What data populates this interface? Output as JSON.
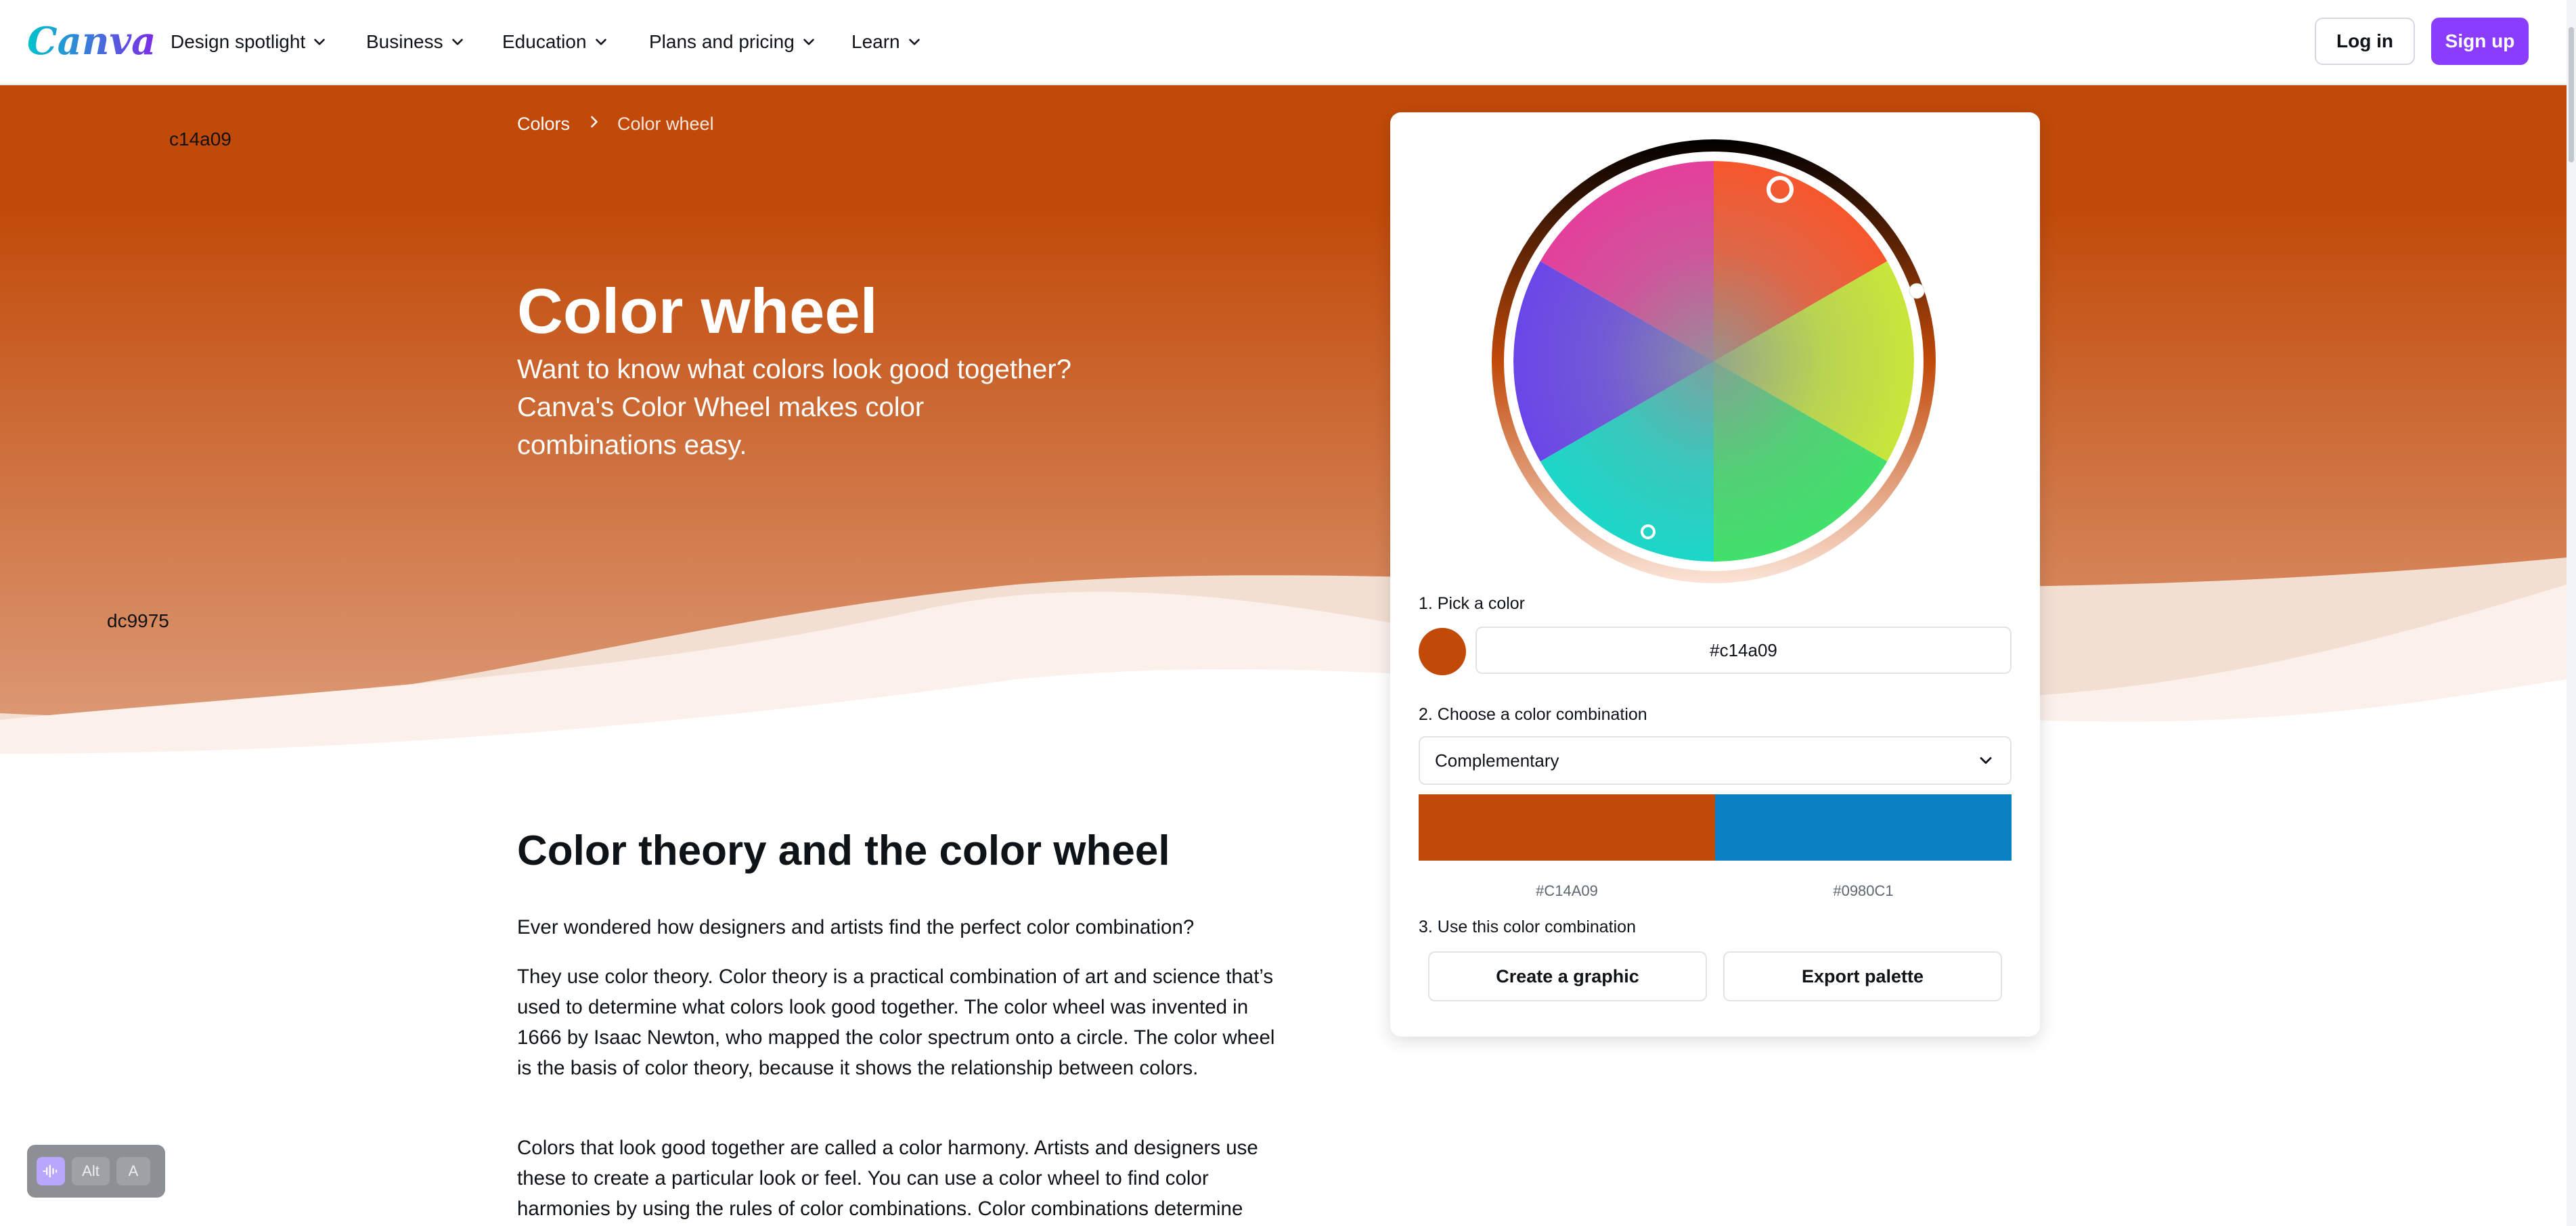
{
  "nav": {
    "logo": "Canva",
    "items": [
      "Design spotlight",
      "Business",
      "Education",
      "Plans and pricing",
      "Learn"
    ],
    "login": "Log in",
    "signup": "Sign up"
  },
  "breadcrumb": {
    "items": [
      "Colors",
      "Color wheel"
    ]
  },
  "hero": {
    "title": "Color wheel",
    "subtitle": "Want to know what colors look good together? Canva's Color Wheel makes color combinations easy.",
    "debug_top": "c14a09",
    "debug_bottom": "dc9975"
  },
  "tool": {
    "step1": "1. Pick a color",
    "hex_value": "#c14a09",
    "step2": "2. Choose a color combination",
    "combination": "Complementary",
    "swatches": [
      {
        "color": "#c14a09",
        "label": "#C14A09"
      },
      {
        "color": "#0980c1",
        "label": "#0980C1"
      }
    ],
    "step3": "3. Use this color combination",
    "create_btn": "Create a graphic",
    "export_btn": "Export palette"
  },
  "content": {
    "heading": "Color theory and the color wheel",
    "paragraphs": [
      "Ever wondered how designers and artists find the perfect color combination?",
      "They use color theory. Color theory is a practical combination of art and science that’s used to determine what colors look good together. The color wheel was invented in 1666 by Isaac Newton, who mapped the color spectrum onto a circle. The color wheel is the basis of color theory, because it shows the relationship between colors.",
      "Colors that look good together are called a color harmony. Artists and designers use these to create a particular look or feel. You can use a color wheel to find color harmonies by using the rules of color combinations. Color combinations determine"
    ]
  },
  "a11y": {
    "alt": "Alt",
    "a": "A"
  },
  "colors": {
    "hero_top": "#c14a09",
    "hero_bottom": "#dc9975",
    "brand_purple": "#8b3dff"
  }
}
